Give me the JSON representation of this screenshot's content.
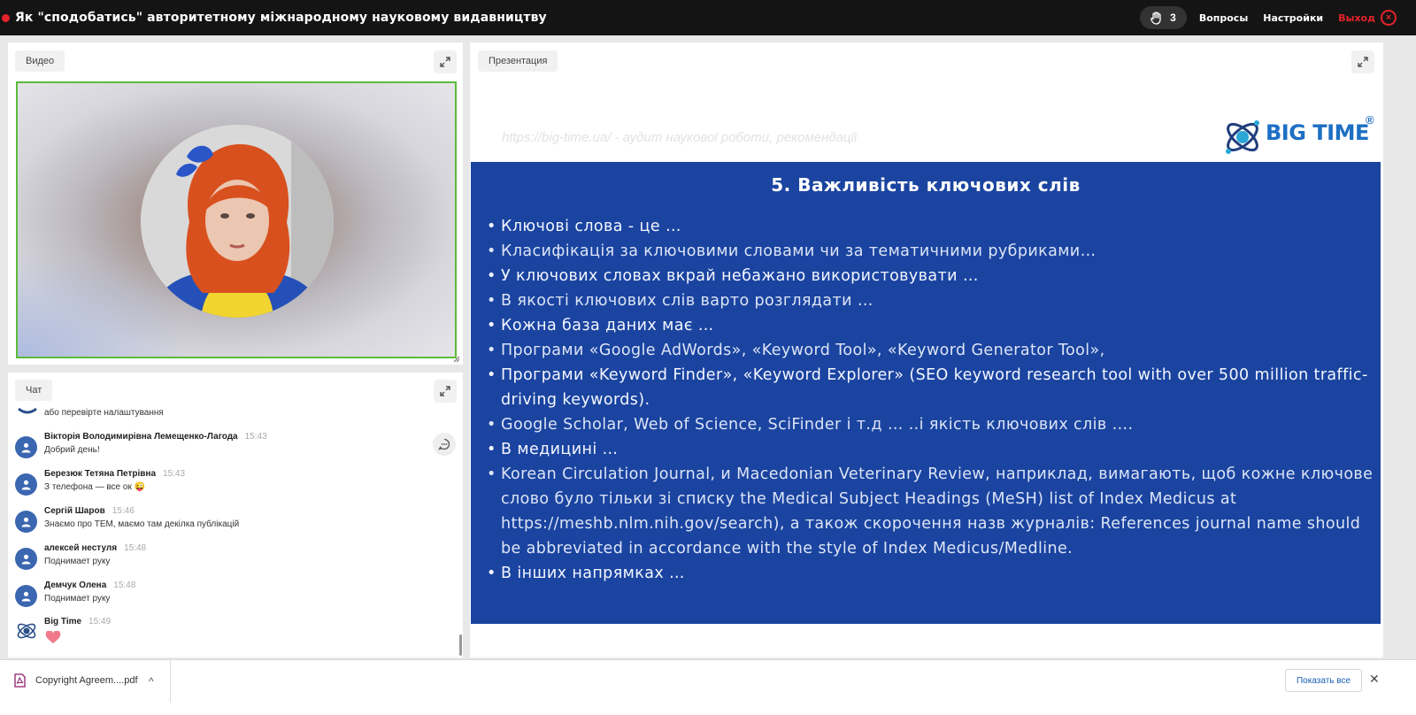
{
  "topbar": {
    "title": "Як \"сподобатись\" авторитетному міжнародному науковому видавництву",
    "raised_hands_count": "3",
    "questions_label": "Вопросы",
    "settings_label": "Настройки",
    "exit_label": "Выход",
    "exit_icon": "×"
  },
  "video": {
    "tag": "Видео"
  },
  "presentation": {
    "tag": "Презентация"
  },
  "chat": {
    "tag": "Чат",
    "partial_message": "або перевірте налаштування",
    "messages": [
      {
        "name": "Вікторія Володимирівна Лемещенко-Лагода",
        "time": "15:43",
        "text": "Добрий день!"
      },
      {
        "name": "Березюк Тетяна Петрівна",
        "time": "15:43",
        "text": "З телефона — все ок 😜"
      },
      {
        "name": "Сергій Шаров",
        "time": "15:46",
        "text": "Знаємо про ТЕМ, маємо там декілка публікацій"
      },
      {
        "name": "алексей нестуля",
        "time": "15:48",
        "text": "Поднимает руку"
      },
      {
        "name": "Демчук Олена",
        "time": "15:48",
        "text": "Поднимает руку"
      },
      {
        "name": "Big Time",
        "time": "15:49",
        "text": ""
      }
    ]
  },
  "slide": {
    "url_line": "https://big-time.ua/ - аудит наукової роботи, рекомендації",
    "logo_text": "BIG TIME",
    "logo_mark": "®",
    "title": "5. Важливість ключових слів",
    "bullets": [
      "Ключові слова - це …",
      "Класифікація за ключовими словами чи за тематичними рубриками…",
      "У ключових словах вкрай небажано використовувати …",
      "В якості ключових слів варто розглядати …",
      "Кожна база даних має …",
      "Програми «Google AdWords», «Keyword Tool», «Keyword Generator Tool»,",
      "Програми «Keyword Finder», «Keyword Explorer» (SEO keyword research tool with over 500 million traffic-driving keywords).",
      "Google Scholar, Web of Science, SciFinder і т.д … ..і якість ключових слів ….",
      "В медицині …",
      "Korean Circulation Journal, и Macedonian Veterinary Review, наприклад, вимагають, щоб кожне ключове слово було тільки зі списку the Medical Subject Headings (MeSH) list of Index Medicus at https://meshb.nlm.nih.gov/search), а також скорочення назв журналів: References journal name should be abbreviated in accordance with the style of Index Medicus/Medline.",
      "В інших напрямках …"
    ]
  },
  "downloads": {
    "file_name": "Copyright Agreem....pdf",
    "show_all_label": "Показать все",
    "close_icon": "✕",
    "chevron_icon": "^"
  },
  "colors": {
    "slide_blue": "#1a44a0",
    "active_speaker_border": "#5dbb3a",
    "exit_red": "#e4232b",
    "topbar_bg": "#141414"
  }
}
